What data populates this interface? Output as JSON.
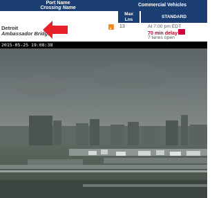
{
  "header": {
    "port_name_label": "Port Name",
    "crossing_name_label": "Crossing Name",
    "commercial_vehicles_label": "Commercial Vehicles",
    "max_lanes_label_1": "Max",
    "max_lanes_label_2": "Lns",
    "standard_label": "STANDARD"
  },
  "row": {
    "city": "Detroit",
    "crossing": "Ambassador Bridge",
    "rss_icon": "rss-feed-icon",
    "max_lanes": "13",
    "time": "At 7:00 pm EDT",
    "delay": "70 min delay",
    "lanes_open": "7 lanes open",
    "delay_color": "#d3003a"
  },
  "camera": {
    "timestamp": "2015-05-25 19:08:38"
  },
  "colors": {
    "header_bg": "#1c3f73",
    "arrow": "#e8202a"
  }
}
